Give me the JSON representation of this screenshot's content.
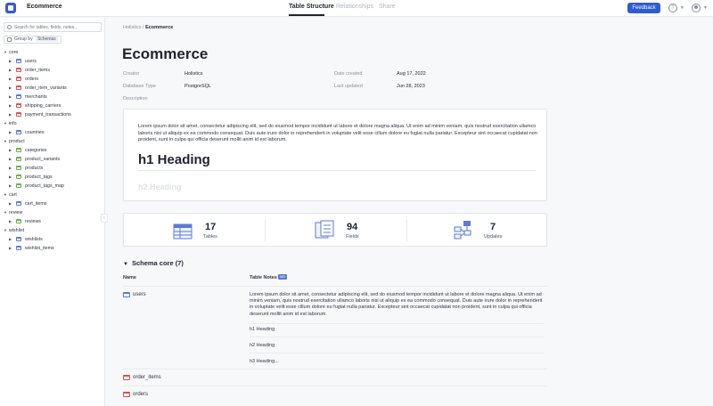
{
  "app": {
    "title": "Ecommerce"
  },
  "nav": {
    "tabs": [
      "Table Structure",
      "Relationships",
      "Share"
    ],
    "active_tab": "Table Structure"
  },
  "header": {
    "feedback_label": "Feedback",
    "help_glyph": "?"
  },
  "sidebar": {
    "search_placeholder": "Search for tables, fields, notes...",
    "group_by_label": "Group by",
    "group_by_value": "Schemas",
    "tree": [
      {
        "label": "core",
        "type": "schema"
      },
      {
        "label": "users",
        "type": "table",
        "color": "blue"
      },
      {
        "label": "order_items",
        "type": "table",
        "color": "red"
      },
      {
        "label": "orders",
        "type": "table",
        "color": "red"
      },
      {
        "label": "order_item_variants",
        "type": "table",
        "color": "red"
      },
      {
        "label": "merchants",
        "type": "table",
        "color": "blue"
      },
      {
        "label": "shipping_carriers",
        "type": "table",
        "color": "red"
      },
      {
        "label": "payment_transactions",
        "type": "table",
        "color": "red"
      },
      {
        "label": "info",
        "type": "schema"
      },
      {
        "label": "countries",
        "type": "table",
        "color": "blue"
      },
      {
        "label": "product",
        "type": "schema"
      },
      {
        "label": "categories",
        "type": "table",
        "color": "green"
      },
      {
        "label": "product_variants",
        "type": "table",
        "color": "green"
      },
      {
        "label": "products",
        "type": "table",
        "color": "green"
      },
      {
        "label": "product_tags",
        "type": "table",
        "color": "green"
      },
      {
        "label": "product_tags_map",
        "type": "table",
        "color": "green"
      },
      {
        "label": "cart",
        "type": "schema"
      },
      {
        "label": "cart_items",
        "type": "table",
        "color": "blue"
      },
      {
        "label": "review",
        "type": "schema"
      },
      {
        "label": "reviews",
        "type": "table",
        "color": "green"
      },
      {
        "label": "wishlist",
        "type": "schema"
      },
      {
        "label": "wishlists",
        "type": "table",
        "color": "blue"
      },
      {
        "label": "wishlist_items",
        "type": "table",
        "color": "blue"
      }
    ]
  },
  "breadcrumb": {
    "parent": "Holistics",
    "separator": "/",
    "current": "Ecommerce"
  },
  "project": {
    "title": "Ecommerce",
    "creator_label": "Creator",
    "creator": "Holistics",
    "db_type_label": "Database Type",
    "db_type": "PostgreSQL",
    "created_label": "Date created",
    "created": "Aug 17, 2022",
    "updated_label": "Last updated",
    "updated": "Jun 28, 2023",
    "description_label": "Description",
    "description_text": "Lorem ipsum dolor sit amet, consectetur adipiscing elit, sed do eiusmod tempor incididunt ut labore et dolore magna aliqua. Ut enim ad minim veniam, quis nostrud exercitation ullamco laboris nisi ut aliquip ex ea commodo consequat. Duis aute irure dolor in reprehenderit in voluptate velit esse cillum dolore eu fugiat nulla pariatur. Excepteur sint occaecat cupidatat non proident, sunt in culpa qui officia deserunt mollit anim id est laborum.",
    "description_heading": "h1 Heading",
    "description_faded": "h2 Heading"
  },
  "stats": [
    {
      "value": "17",
      "label": "Tables"
    },
    {
      "value": "94",
      "label": "Fields"
    },
    {
      "value": "7",
      "label": "Updates"
    }
  ],
  "schema_section": {
    "title": "Schema core (7)",
    "col_name": "Name",
    "col_notes": "Table Notes",
    "md_badge": "MD",
    "rows": [
      {
        "name": "users",
        "note": "Lorem ipsum dolor sit amet, consectetur adipiscing elit, sed do eiusmod tempor incididunt ut labore et dolore magna aliqua. Ut enim ad minim veniam, quis nostrud exercitation ullamco laboris nisi ut aliquip ex ea commodo consequat. Duis aute irure dolor in reprehenderit in voluptate velit esse cillum dolore eu fugiat nulla pariatur. Excepteur sint occaecat cupidatat non proident, sunt in culpa qui officia deserunt mollit anim id est laborum.",
        "note_lines": [
          "h1 Heading",
          "h2 Heading",
          "h3 Heading..."
        ]
      },
      {
        "name": "order_items"
      },
      {
        "name": "orders"
      }
    ]
  }
}
